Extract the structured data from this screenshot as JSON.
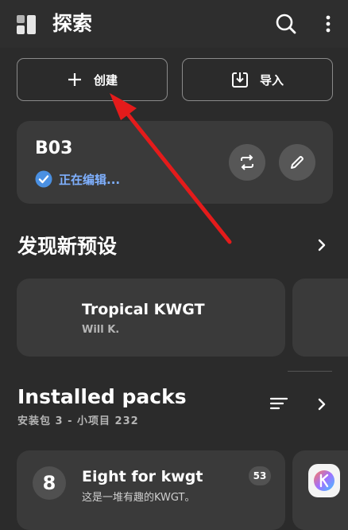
{
  "app": {
    "title": "探索"
  },
  "actions": {
    "create_label": "创建",
    "import_label": "导入"
  },
  "current_preset": {
    "name": "B03",
    "status": "正在编辑..."
  },
  "discover": {
    "heading": "发现新预设",
    "cards": [
      {
        "name": "Tropical KWGT",
        "author": "Will K."
      }
    ]
  },
  "installed": {
    "heading": "Installed packs",
    "subtitle": "安装包 3 - 小项目 232",
    "packs": [
      {
        "name": "Eight for kwgt",
        "desc": "这是一堆有趣的KWGT。",
        "count": "53",
        "icon_text": "8"
      }
    ]
  },
  "colors": {
    "background": "#2b2b2b",
    "card": "#3a3a3a",
    "accent_blue": "#4a90e2",
    "annotation_arrow": "#e41b1b"
  },
  "icons": {
    "app": "widget-grid-icon",
    "search": "search-icon",
    "more": "more-vert-icon",
    "create": "plus-icon",
    "import": "import-download-icon",
    "status": "check-circle-icon",
    "sync": "sync-icon",
    "edit": "pencil-icon",
    "chevron": "chevron-right-icon",
    "sort": "sort-icon"
  }
}
